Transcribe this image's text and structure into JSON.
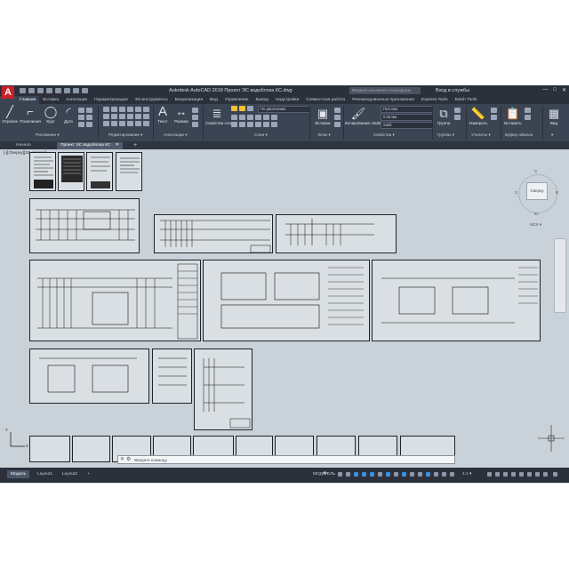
{
  "app": {
    "logo": "A",
    "title": "Autodesk AutoCAD 2018   Проект ЭС водоблока КС.dwg",
    "search_placeholder": "Введите ключевое слово/фразу",
    "login": "Вход в службы",
    "window_controls": [
      "—",
      "□",
      "✕"
    ]
  },
  "menu_tabs": [
    "Главная",
    "Вставка",
    "Аннотации",
    "Параметризация",
    "3D-инструменты",
    "Визуализация",
    "Вид",
    "Управление",
    "Вывод",
    "Надстройки",
    "Совместная работа",
    "Рекомендованные приложения",
    "Express Tools",
    "Batch Tools"
  ],
  "ribbon": {
    "draw": {
      "buttons": [
        "Отрезок",
        "Полилиния",
        "Круг",
        "Дуга"
      ],
      "title": "Рисование ▾"
    },
    "modify": {
      "title": "Редактирование ▾"
    },
    "annotation": {
      "buttons": [
        "Текст",
        "Размер"
      ],
      "title": "Аннотации ▾"
    },
    "layers": {
      "buttons": [
        "Свойства слоя"
      ],
      "current_layer": "По умолчанию",
      "title": "Слои ▾"
    },
    "block": {
      "buttons": [
        "Вставка"
      ],
      "title": "Блок ▾"
    },
    "properties": {
      "buttons": [
        "Копирование свойств"
      ],
      "color": "ПоСлою",
      "lineweight": "0.00 мм",
      "linetype": "Solid",
      "title": "Свойства ▾"
    },
    "groups": {
      "buttons": [
        "Группа"
      ],
      "title": "Группы ▾"
    },
    "utilities": {
      "buttons": [
        "Измерить"
      ],
      "title": "Утилиты ▾"
    },
    "clipboard": {
      "buttons": [
        "Вставить"
      ],
      "title": "Буфер обмена"
    },
    "view": {
      "buttons": [
        "Вид"
      ],
      "title": "▾"
    }
  },
  "file_tabs": {
    "start": "Начало",
    "current": "Проект ЭС водоблока КС",
    "close": "✕",
    "add": "+"
  },
  "drawing": {
    "view_label": "[-][Сверху][2D-каркас]",
    "viewcube_face": "Сверху",
    "viewcube_compass": [
      "С",
      "Ю",
      "З",
      "В"
    ],
    "ucs_label": "МСК ▾",
    "command_placeholder": "Введите команду",
    "ucs_axes": [
      "X",
      "Y"
    ]
  },
  "status": {
    "layout_tabs": [
      "Модель",
      "Layout1",
      "Layout2"
    ],
    "add_tab": "+",
    "model_label": "МОД�ЕЛЬ",
    "scale": "1:1 ▾"
  }
}
